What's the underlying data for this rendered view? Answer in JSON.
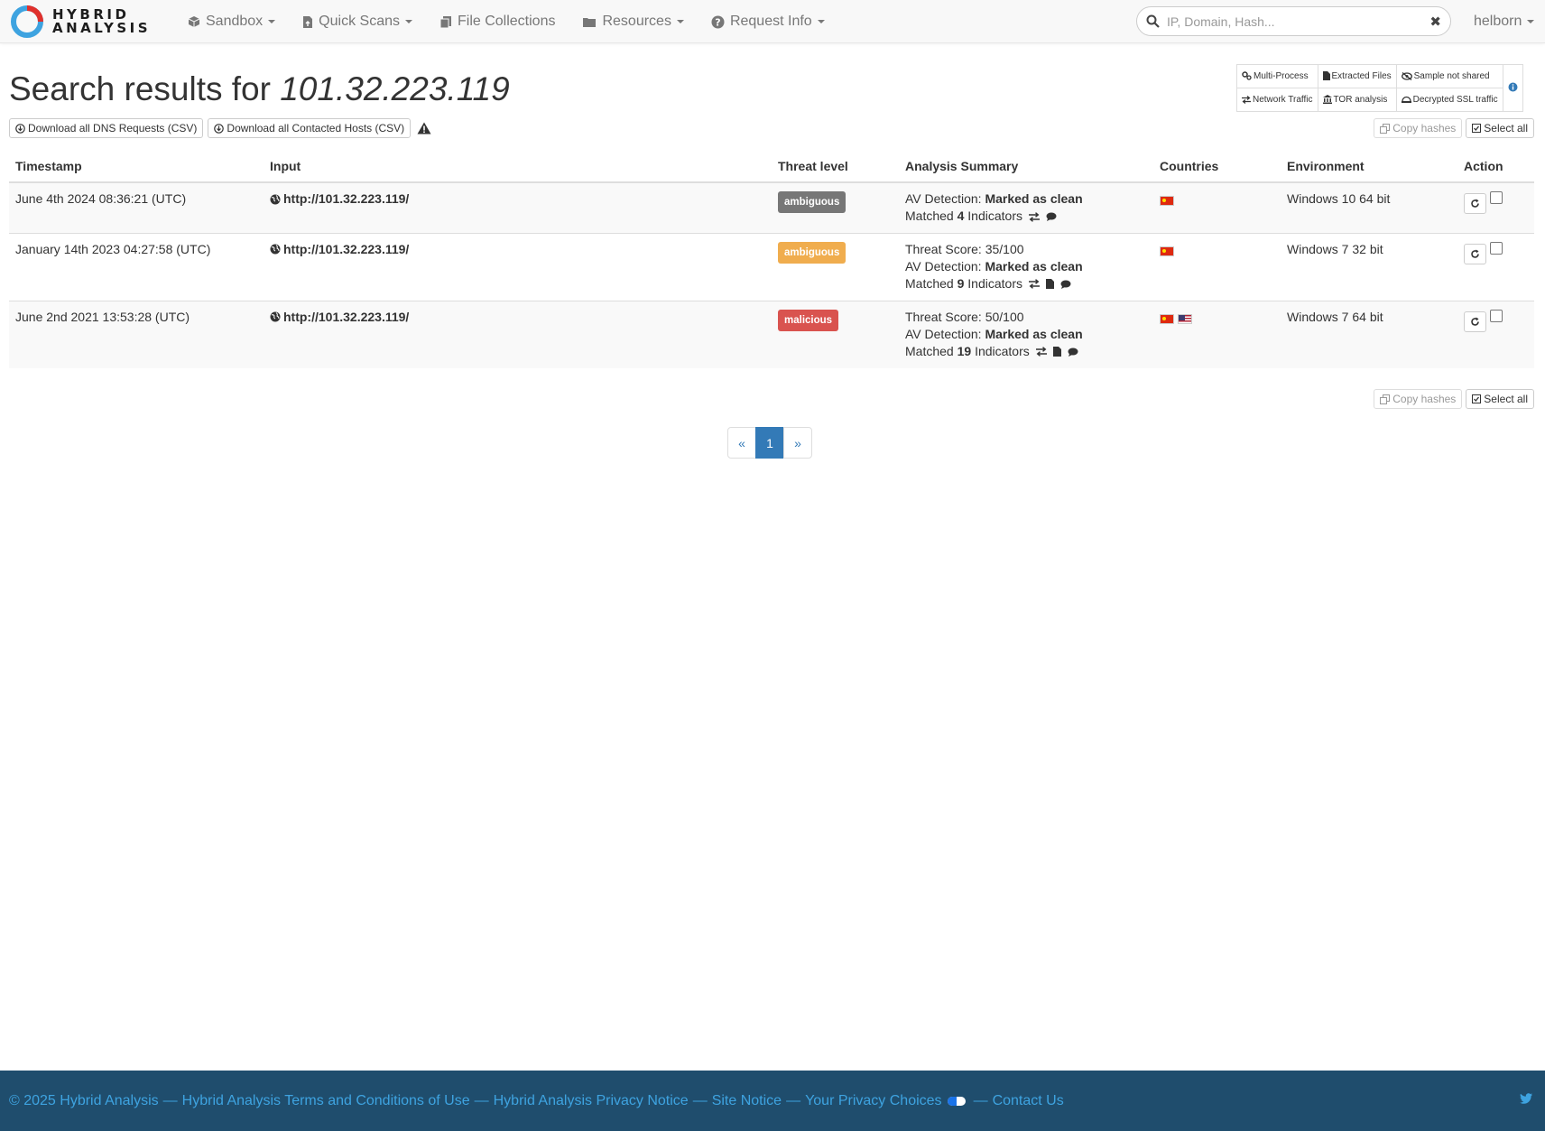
{
  "brand": {
    "line1": "HYBRID",
    "line2": "ANALYSIS"
  },
  "nav": {
    "items": [
      {
        "label": "Sandbox",
        "icon": "cube-icon",
        "dropdown": true
      },
      {
        "label": "Quick Scans",
        "icon": "file-upload-icon",
        "dropdown": true
      },
      {
        "label": "File Collections",
        "icon": "files-icon",
        "dropdown": false
      },
      {
        "label": "Resources",
        "icon": "folder-icon",
        "dropdown": true
      },
      {
        "label": "Request Info",
        "icon": "question-circle-icon",
        "dropdown": true
      }
    ],
    "search_placeholder": "IP, Domain, Hash...",
    "search_value": "",
    "clear": "✖",
    "user": "helborn"
  },
  "header": {
    "title_prefix": "Search results for",
    "query": "101.32.223.119",
    "download_dns": "Download all DNS Requests (CSV)",
    "download_hosts": "Download all Contacted Hosts (CSV)"
  },
  "legend": {
    "row1": [
      "Multi-Process",
      "Extracted Files",
      "Sample not shared"
    ],
    "row2": [
      "Network Traffic",
      "TOR analysis",
      "Decrypted SSL traffic"
    ]
  },
  "actions": {
    "copy_hashes": "Copy hashes",
    "select_all": "Select all"
  },
  "table": {
    "headers": [
      "Timestamp",
      "Input",
      "Threat level",
      "Analysis Summary",
      "Countries",
      "Environment",
      "Action"
    ],
    "rows": [
      {
        "timestamp": "June 4th 2024 08:36:21 (UTC)",
        "input": "http://101.32.223.119/",
        "threat_level": "ambiguous",
        "threat_color": "#777777",
        "threat_score": "",
        "av_label": "AV Detection:",
        "av_value": "Marked as clean",
        "matched_prefix": "Matched",
        "matched_count": "4",
        "matched_suffix": "Indicators",
        "icons": [
          "exchange-icon",
          "comment-icon"
        ],
        "countries": [
          "cn"
        ],
        "environment": "Windows 10 64 bit"
      },
      {
        "timestamp": "January 14th 2023 04:27:58 (UTC)",
        "input": "http://101.32.223.119/",
        "threat_level": "ambiguous",
        "threat_color": "#f0ad4e",
        "threat_score": "Threat Score: 35/100",
        "av_label": "AV Detection:",
        "av_value": "Marked as clean",
        "matched_prefix": "Matched",
        "matched_count": "9",
        "matched_suffix": "Indicators",
        "icons": [
          "exchange-icon",
          "file-icon",
          "comment-icon"
        ],
        "countries": [
          "cn"
        ],
        "environment": "Windows 7 32 bit"
      },
      {
        "timestamp": "June 2nd 2021 13:53:28 (UTC)",
        "input": "http://101.32.223.119/",
        "threat_level": "malicious",
        "threat_color": "#d9534f",
        "threat_score": "Threat Score: 50/100",
        "av_label": "AV Detection:",
        "av_value": "Marked as clean",
        "matched_prefix": "Matched",
        "matched_count": "19",
        "matched_suffix": "Indicators",
        "icons": [
          "exchange-icon",
          "file-icon",
          "comment-icon"
        ],
        "countries": [
          "cn",
          "us"
        ],
        "environment": "Windows 7 64 bit"
      }
    ]
  },
  "pagination": {
    "prev": "«",
    "current": "1",
    "next": "»"
  },
  "footer": {
    "copyright": "© 2025 Hybrid Analysis",
    "terms": "Hybrid Analysis Terms and Conditions of Use",
    "privacy": "Hybrid Analysis Privacy Notice",
    "site_notice": "Site Notice",
    "choices": "Your Privacy Choices",
    "contact": "Contact Us",
    "separator": "—"
  },
  "colors": {
    "accent": "#337ab7",
    "footer_bg": "#1f4d6d",
    "footer_link": "#3ea3e0",
    "logo_red": "#e0302c",
    "logo_blue": "#3ea3e0"
  }
}
